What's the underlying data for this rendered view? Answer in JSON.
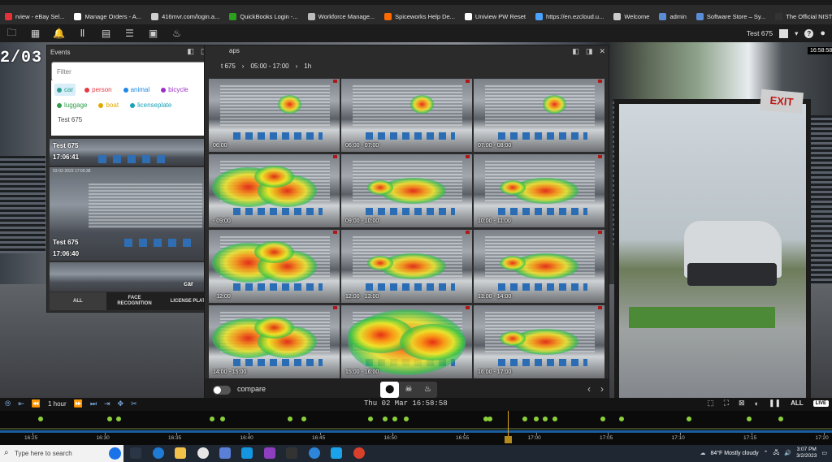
{
  "bookmarks": [
    {
      "label": "rview - eBay Sel...",
      "icon": "ebay-icon",
      "color": "#e53238"
    },
    {
      "label": "Manage Orders - A...",
      "icon": "amazon-icon",
      "color": "#ffffff"
    },
    {
      "label": "416mvr.com/login.a...",
      "icon": "page-icon",
      "color": "#cfcfcf"
    },
    {
      "label": "QuickBooks Login -...",
      "icon": "quickbooks-icon",
      "color": "#2ca01c"
    },
    {
      "label": "Workforce Manage...",
      "icon": "workforce-icon",
      "color": "#bbbbbb"
    },
    {
      "label": "Spiceworks Help De...",
      "icon": "spiceworks-icon",
      "color": "#ff6a00"
    },
    {
      "label": "Uniview PW Reset",
      "icon": "github-icon",
      "color": "#ffffff"
    },
    {
      "label": "https://en.ezcloud.u...",
      "icon": "link-icon",
      "color": "#4aa3ff"
    },
    {
      "label": "Welcome",
      "icon": "welcome-icon",
      "color": "#cccccc"
    },
    {
      "label": "admin",
      "icon": "globe-icon",
      "color": "#5b8dd6"
    },
    {
      "label": "Software Store – Sy...",
      "icon": "globe-icon",
      "color": "#5b8dd6"
    },
    {
      "label": "The Official NIST U...",
      "icon": "nist-icon",
      "color": "#333333"
    },
    {
      "label": "PATTERN: Crochet...",
      "icon": "etsy-icon",
      "color": "#f1641e"
    }
  ],
  "toolbar": {
    "icons": [
      "folder-icon",
      "grid-icon",
      "bell-icon",
      "library-icon",
      "map-icon",
      "list-icon",
      "layout-icon",
      "flame-icon"
    ],
    "site_name": "Test 675",
    "help_icon": "help-icon",
    "user_icon": "user-icon"
  },
  "video": {
    "clock_left": "2/03",
    "clock_right": "16:58:58",
    "exit_sign": "EXIT"
  },
  "events_panel": {
    "title": "Events",
    "filter_placeholder": "Filter",
    "tags": [
      {
        "label": "car",
        "color": "#2a9d8f",
        "selected": true
      },
      {
        "label": "person",
        "color": "#e63946",
        "selected": false
      },
      {
        "label": "animal",
        "color": "#1e88e5",
        "selected": false
      },
      {
        "label": "bicycle",
        "color": "#9b30c8",
        "selected": false
      },
      {
        "label": "luggage",
        "color": "#2e9d4a",
        "selected": false
      },
      {
        "label": "boat",
        "color": "#e0a800",
        "selected": false
      },
      {
        "label": "licenseplate",
        "color": "#17a2b8",
        "selected": false
      }
    ],
    "recent_search": "Test 675",
    "items": [
      {
        "camera": "Test 675",
        "time": "17:06:41",
        "tag": ""
      },
      {
        "camera": "Test 675",
        "time": "17:06:40",
        "tag": ""
      },
      {
        "camera": "",
        "time": "",
        "tag": "car"
      }
    ],
    "tabs": [
      {
        "label": "ALL",
        "active": true
      },
      {
        "label": "FACE\nRECOGNITION",
        "active": false
      },
      {
        "label": "LICENSE PLATES",
        "active": false
      }
    ]
  },
  "heatmaps_panel": {
    "title": "aps",
    "breadcrumb": [
      "t 675",
      "05:00 - 17:00",
      "1h"
    ],
    "cells": [
      {
        "label": "06:00",
        "intensity": "low"
      },
      {
        "label": "06:00 - 07:00",
        "intensity": "low"
      },
      {
        "label": "07:00 - 08:00",
        "intensity": "low"
      },
      {
        "label": "- 09:00",
        "intensity": "high"
      },
      {
        "label": "09:00 - 10:00",
        "intensity": "medium"
      },
      {
        "label": "10:00 - 11:00",
        "intensity": "medium"
      },
      {
        "label": "- 12:00",
        "intensity": "high"
      },
      {
        "label": "12:00 - 13:00",
        "intensity": "medium"
      },
      {
        "label": "13:00 - 14:00",
        "intensity": "medium"
      },
      {
        "label": "14:00 - 15:00",
        "intensity": "high"
      },
      {
        "label": "15:00 - 16:00",
        "intensity": "very-high"
      },
      {
        "label": "16:00 - 17:00",
        "intensity": "medium"
      }
    ],
    "compare_label": "compare",
    "modes": [
      "palette-icon",
      "skull-icon",
      "flame-icon"
    ]
  },
  "player": {
    "interval_label": "1 hour",
    "datetime": "Thu 02 Mar  16:58:58",
    "live_label": "ALL",
    "live_badge": "LIVE"
  },
  "timeline": {
    "ticks": [
      "16:25",
      "16:30",
      "16:35",
      "16:40",
      "16:45",
      "16:50",
      "16:55",
      "17:00",
      "17:05",
      "17:10",
      "17:15",
      "17:20"
    ]
  },
  "taskbar": {
    "search_placeholder": "Type here to search",
    "weather": "84°F  Mostly cloudy",
    "time": "3:07 PM",
    "date": "3/2/2023"
  }
}
